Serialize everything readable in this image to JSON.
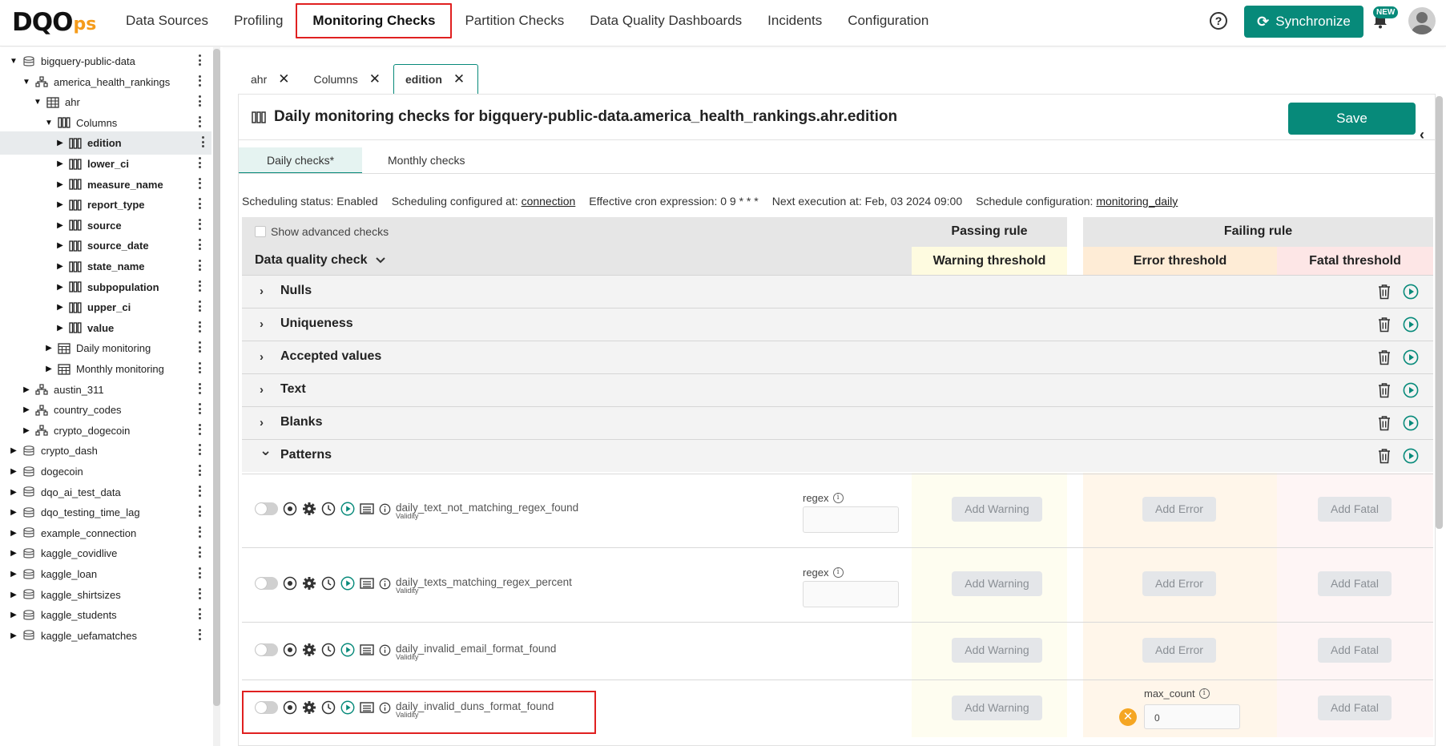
{
  "app": {
    "logo_main": "DQO",
    "logo_suffix": "ps"
  },
  "nav": {
    "items": [
      "Data Sources",
      "Profiling",
      "Monitoring Checks",
      "Partition Checks",
      "Data Quality Dashboards",
      "Incidents",
      "Configuration"
    ],
    "active": "Monitoring Checks"
  },
  "header": {
    "help_icon": "?",
    "sync_label": "Synchronize",
    "new_badge": "NEW",
    "accent_color": "#078a7a"
  },
  "sidebar": {
    "items": [
      {
        "label": "bigquery-public-data",
        "icon": "database-icon",
        "caret": "▼",
        "bold": false
      },
      {
        "label": "america_health_rankings",
        "icon": "schema-icon",
        "caret": "▼",
        "bold": false
      },
      {
        "label": "ahr",
        "icon": "table-icon",
        "caret": "▼",
        "bold": false
      },
      {
        "label": "Columns",
        "icon": "columns-icon",
        "caret": "▼",
        "bold": false
      },
      {
        "label": "edition",
        "icon": "columns-icon",
        "caret": "▶",
        "bold": true,
        "selected": true
      },
      {
        "label": "lower_ci",
        "icon": "columns-icon",
        "caret": "▶",
        "bold": true
      },
      {
        "label": "measure_name",
        "icon": "columns-icon",
        "caret": "▶",
        "bold": true
      },
      {
        "label": "report_type",
        "icon": "columns-icon",
        "caret": "▶",
        "bold": true
      },
      {
        "label": "source",
        "icon": "columns-icon",
        "caret": "▶",
        "bold": true
      },
      {
        "label": "source_date",
        "icon": "columns-icon",
        "caret": "▶",
        "bold": true
      },
      {
        "label": "state_name",
        "icon": "columns-icon",
        "caret": "▶",
        "bold": true
      },
      {
        "label": "subpopulation",
        "icon": "columns-icon",
        "caret": "▶",
        "bold": true
      },
      {
        "label": "upper_ci",
        "icon": "columns-icon",
        "caret": "▶",
        "bold": true
      },
      {
        "label": "value",
        "icon": "columns-icon",
        "caret": "▶",
        "bold": true
      },
      {
        "label": "Daily monitoring",
        "icon": "calendar-table-icon",
        "caret": "▶",
        "bold": false
      },
      {
        "label": "Monthly monitoring",
        "icon": "calendar-table-icon",
        "caret": "▶",
        "bold": false
      },
      {
        "label": "austin_311",
        "icon": "schema-icon",
        "caret": "▶",
        "bold": false
      },
      {
        "label": "country_codes",
        "icon": "schema-icon",
        "caret": "▶",
        "bold": false
      },
      {
        "label": "crypto_dogecoin",
        "icon": "schema-icon",
        "caret": "▶",
        "bold": false
      },
      {
        "label": "crypto_dash",
        "icon": "database-icon",
        "caret": "▶",
        "bold": false
      },
      {
        "label": "dogecoin",
        "icon": "database-icon",
        "caret": "▶",
        "bold": false
      },
      {
        "label": "dqo_ai_test_data",
        "icon": "database-icon",
        "caret": "▶",
        "bold": false
      },
      {
        "label": "dqo_testing_time_lag",
        "icon": "database-icon",
        "caret": "▶",
        "bold": false
      },
      {
        "label": "example_connection",
        "icon": "database-icon",
        "caret": "▶",
        "bold": false
      },
      {
        "label": "kaggle_covidlive",
        "icon": "database-icon",
        "caret": "▶",
        "bold": false
      },
      {
        "label": "kaggle_loan",
        "icon": "database-icon",
        "caret": "▶",
        "bold": false
      },
      {
        "label": "kaggle_shirtsizes",
        "icon": "database-icon",
        "caret": "▶",
        "bold": false
      },
      {
        "label": "kaggle_students",
        "icon": "database-icon",
        "caret": "▶",
        "bold": false
      },
      {
        "label": "kaggle_uefamatches",
        "icon": "database-icon",
        "caret": "▶",
        "bold": false
      }
    ]
  },
  "tabs": [
    {
      "label": "ahr",
      "close": "✕"
    },
    {
      "label": "Columns",
      "close": "✕"
    },
    {
      "label": "edition",
      "close": "✕",
      "active": true
    }
  ],
  "main": {
    "title": "Daily monitoring checks for bigquery-public-data.america_health_rankings.ahr.edition",
    "save_label": "Save",
    "collapse_glyph": "‹",
    "subtabs": [
      "Daily checks*",
      "Monthly checks"
    ],
    "schedule": {
      "status": "Scheduling status: Enabled",
      "configured_label": "Scheduling configured at: ",
      "configured_link": "connection",
      "cron": "Effective cron expression: 0 9 * * *",
      "next": "Next execution at: Feb, 03 2024 09:00",
      "config_label": "Schedule configuration: ",
      "config_link": "monitoring_daily"
    },
    "table": {
      "show_advanced": "Show advanced checks",
      "passing_rule": "Passing rule",
      "failing_rule": "Failing rule",
      "dq_check_header": "Data quality check",
      "warning_threshold": "Warning threshold",
      "error_threshold": "Error threshold",
      "fatal_threshold": "Fatal threshold",
      "categories": [
        {
          "name": "Nulls",
          "chev": "›"
        },
        {
          "name": "Uniqueness",
          "chev": "›"
        },
        {
          "name": "Accepted values",
          "chev": "›"
        },
        {
          "name": "Text",
          "chev": "›"
        },
        {
          "name": "Blanks",
          "chev": "›"
        },
        {
          "name": "Patterns",
          "chev": "⌄"
        }
      ],
      "checks": [
        {
          "name": "daily_text_not_matching_regex_found",
          "dimension": "Validity",
          "param": "regex"
        },
        {
          "name": "daily_texts_matching_regex_percent",
          "dimension": "Validity",
          "param": "regex"
        },
        {
          "name": "daily_invalid_email_format_found",
          "dimension": "Validity"
        },
        {
          "name": "daily_invalid_duns_format_found",
          "dimension": "Validity",
          "error_param": "max_count",
          "error_value": "0"
        }
      ],
      "add_warning": "Add Warning",
      "add_error": "Add Error",
      "add_fatal": "Add Fatal",
      "info_glyph": "i",
      "remove_glyph": "✕"
    }
  }
}
